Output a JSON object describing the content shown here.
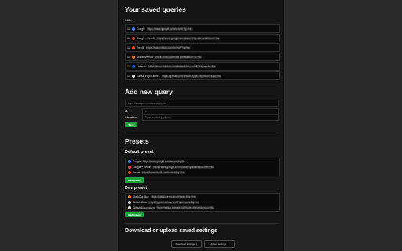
{
  "saved": {
    "title": "Your saved queries",
    "filter_label": "Filter",
    "queries": [
      {
        "name": "Google",
        "url": "https://www.google.com/search?q=%s",
        "color": "#4285f4"
      },
      {
        "name": "Google - Reddit",
        "url": "https://www.google.com/search?q=site:reddit.com+%s",
        "color": "#ea4335"
      },
      {
        "name": "Reddit",
        "url": "https://www.reddit.com/search/?q=%s",
        "color": "#ff4500"
      },
      {
        "name": "StackOverflow",
        "url": "https://stackoverflow.com/search?q=%s",
        "color": "#f48024"
      },
      {
        "name": "LinkedIn",
        "url": "https://www.linkedin.com/search/results/all/?keywords=%s",
        "color": "#0a66c2"
      },
      {
        "name": "GitHub Repositories",
        "url": "https://github.com/search?type=repositories&q=%s",
        "color": "#e0e0e0"
      }
    ]
  },
  "add": {
    "title": "Add new query",
    "url_placeholder": "https://example.com/search?q=%s",
    "id_label": "ID",
    "id_placeholder": "0",
    "shortcut_label": "Shortcut",
    "shortcut_placeholder": "Type shortcut (optional)",
    "save_label": "Save"
  },
  "presets": {
    "title": "Presets",
    "default": {
      "title": "Default preset",
      "items": [
        {
          "name": "Google",
          "url": "https://www.google.com/search?q=%s",
          "color": "#4285f4"
        },
        {
          "name": "Google + Reddit",
          "url": "https://www.google.com/search?q=site:reddit.com+%s",
          "color": "#ea4335"
        },
        {
          "name": "Reddit",
          "url": "https://www.reddit.com/search/?q=%s",
          "color": "#ff4500"
        }
      ],
      "apply_label": "Add preset"
    },
    "dev": {
      "title": "Dev preset",
      "items": [
        {
          "name": "StackOverflow",
          "url": "https://stackoverflow.com/search?q=%s",
          "color": "#f48024"
        },
        {
          "name": "GitHub Code",
          "url": "https://github.com/search?type=code&q=%s",
          "color": "#e0e0e0"
        },
        {
          "name": "GitHub Discussions",
          "url": "https://github.com/search?type=discussions&q=%s",
          "color": "#e0e0e0"
        }
      ],
      "apply_label": "Add preset"
    }
  },
  "backup": {
    "title": "Download or upload saved settings",
    "download_label": "Download settings",
    "upload_label": "Upload settings"
  }
}
